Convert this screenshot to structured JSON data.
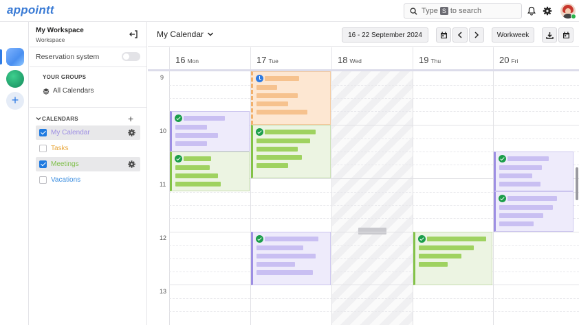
{
  "app": {
    "logo": "appointt"
  },
  "search": {
    "prefix": "Type",
    "key": "S",
    "suffix": "to search"
  },
  "workspace": {
    "name": "My Workspace",
    "subtitle": "Workspace"
  },
  "sidebar": {
    "reservation_label": "Reservation system",
    "reservation_enabled": false,
    "groups_title": "YOUR GROUPS",
    "all_calendars": "All Calendars",
    "calendars_title": "CALENDARS",
    "calendars": [
      {
        "label": "My Calendar",
        "checked": true,
        "color": "#9d8ee3"
      },
      {
        "label": "Tasks",
        "checked": false,
        "color": "#e8a73c"
      },
      {
        "label": "Meetings",
        "checked": true,
        "color": "#7fbf4a"
      },
      {
        "label": "Vacations",
        "checked": false,
        "color": "#3e8fe0"
      }
    ]
  },
  "toolbar": {
    "calendar_select": "My Calendar",
    "date_range": "16 - 22 September 2024",
    "view": "Workweek"
  },
  "days": [
    {
      "num": "16",
      "wd": "Mon"
    },
    {
      "num": "17",
      "wd": "Tue"
    },
    {
      "num": "18",
      "wd": "Wed"
    },
    {
      "num": "19",
      "wd": "Thu"
    },
    {
      "num": "20",
      "wd": "Fri"
    }
  ],
  "hours": [
    "9",
    "10",
    "11",
    "12",
    "13"
  ],
  "colors": {
    "accent": "#2f7be5",
    "purple": "#9d8ee3",
    "green": "#83c247",
    "orange": "#f2b06b"
  }
}
